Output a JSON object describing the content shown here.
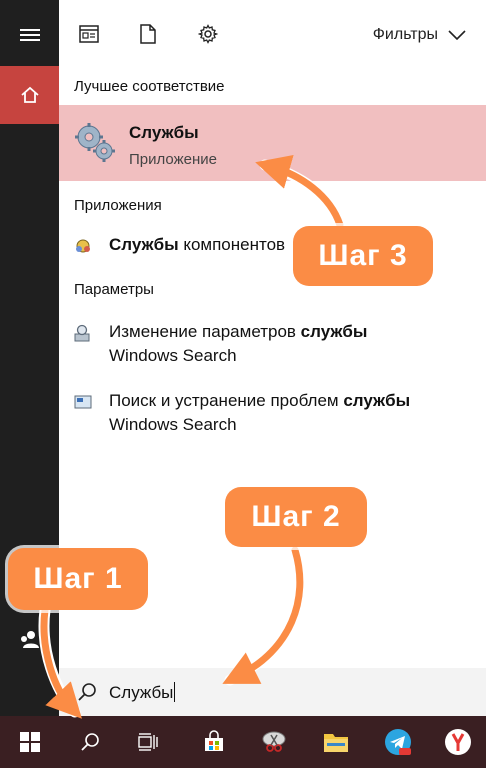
{
  "toolbar": {
    "filters_label": "Фильтры"
  },
  "sections": {
    "best_match": "Лучшее соответствие",
    "apps": "Приложения",
    "settings": "Параметры"
  },
  "best_match": {
    "name": "Службы",
    "type": "Приложение"
  },
  "apps": [
    {
      "bold": "Службы",
      "rest": " компонентов"
    }
  ],
  "settings": [
    {
      "pre": "Изменение параметров ",
      "bold": "службы",
      "line2": "Windows Search"
    },
    {
      "pre": "Поиск и устранение проблем ",
      "bold": "службы",
      "line2": "Windows Search"
    }
  ],
  "search": {
    "value": "Службы"
  },
  "callouts": {
    "step1": "Шаг 1",
    "step2": "Шаг 2",
    "step3": "Шаг 3"
  },
  "colors": {
    "accent_red": "#c6443f",
    "highlight": "#f1bfc0",
    "callout": "#fb8c45",
    "taskbar": "#3a1f22",
    "rail": "#1f1f1f"
  }
}
